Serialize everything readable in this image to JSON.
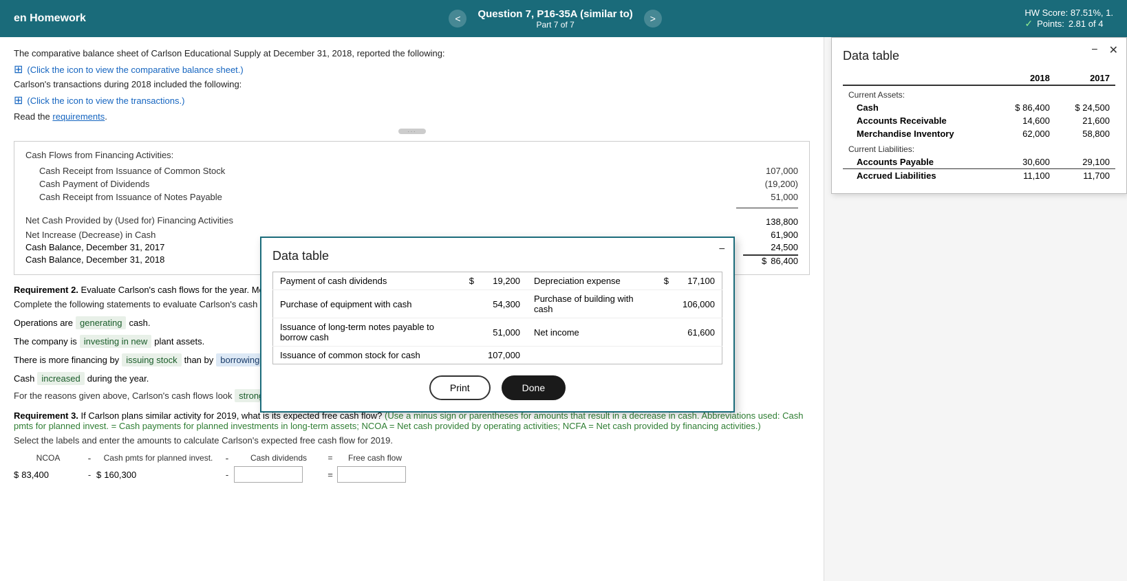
{
  "topBar": {
    "leftTitle": "en Homework",
    "questionTitle": "Question 7, P16-35A (similar to)",
    "partLabel": "Part 7 of 7",
    "hwScore": "HW Score: 87.51%, 1.",
    "pointsLabel": "Points:",
    "pointsValue": "2.81 of 4",
    "navPrev": "<",
    "navNext": ">"
  },
  "intro": {
    "line1": "The comparative balance sheet of Carlson Educational Supply at December 31, 2018, reported the following:",
    "link1": "(Click the icon to view the comparative balance sheet.)",
    "line2": "Carlson's transactions during 2018 included the following:",
    "link2": "(Click the icon to view the transactions.)",
    "readLabel": "Read the",
    "requirementsText": "requirements"
  },
  "cashFlowTable": {
    "sectionHeader": "Cash Flows from Financing Activities:",
    "rows": [
      {
        "label": "Cash Receipt from Issuance of Common Stock",
        "amount": "107,000"
      },
      {
        "label": "Cash Payment of Dividends",
        "amount": "(19,200)"
      },
      {
        "label": "Cash Receipt from Issuance of Notes Payable",
        "amount": "51,000"
      }
    ],
    "netLabel": "Net Cash Provided by (Used for) Financing Activities",
    "netAmount": "138,800",
    "netIncLabel": "Net Increase (Decrease) in Cash",
    "netIncAmount": "61,900",
    "balLabel1": "Cash Balance, December 31, 2017",
    "balAmount1": "24,500",
    "balLabel2": "Cash Balance, December 31, 2018",
    "balDollar": "$",
    "balAmount2": "86,400"
  },
  "req2": {
    "header": "Requirement 2.",
    "headerRest": "Evaluate Carlson's cash flows for the year. Mention all three categories of cash flows, and give the reason for your evaluation.",
    "completeLabel": "Complete the following statements to evaluate Carlson's cash flows.",
    "stmt1Pre": "Operations are",
    "stmt1Highlight": "generating",
    "stmt1Post": "cash.",
    "stmt2Pre": "The company is",
    "stmt2Highlight": "investing in new",
    "stmt2Post": "plant assets.",
    "stmt3Pre": "There is more financing by",
    "stmt3Highlight": "issuing stock",
    "stmt3Mid": "than by",
    "stmt3Highlight2": "borrowing.",
    "stmt4Pre": "Cash",
    "stmt4Highlight": "increased",
    "stmt4Post": "during the year.",
    "evalPre": "For the reasons given above, Carlson's cash flows look",
    "evalHighlight": "strong"
  },
  "req3": {
    "header": "Requirement 3.",
    "headerRest": "If Carlson plans similar activity for 2019, what is its expected free cash flow?",
    "greenNote": "(Use a minus sign or parentheses for amounts that result in a decrease in cash. Abbreviations used: Cash pmts for planned invest. = Cash payments for planned investments in long-term assets; NCOA = Net cash provided by operating activities; NCFA = Net cash provided by financing activities.)",
    "selectLabel": "Select the labels and enter the amounts to calculate Carlson's expected free cash flow for 2019.",
    "calcHeaders": {
      "col1": "NCOA",
      "sep1": "-",
      "col2": "Cash pmts for planned invest.",
      "sep2": "-",
      "col3": "Cash dividends",
      "eq": "=",
      "col4": "Free cash flow"
    },
    "calcValues": {
      "dollar1": "$",
      "val1": "83,400",
      "sep1": "-",
      "dollar2": "$",
      "val2": "160,300",
      "sep2": "-",
      "inputPlaceholder": "",
      "eqSign": "=",
      "resultPlaceholder": ""
    }
  },
  "dataTable1": {
    "title": "Data table",
    "cols": [
      "",
      "2018",
      "2017"
    ],
    "sections": [
      {
        "sectionLabel": "Current Assets:",
        "rows": [
          {
            "label": "Cash",
            "dollar": "$",
            "val2018": "86,400",
            "dollar2": "$",
            "val2017": "24,500"
          },
          {
            "label": "Accounts Receivable",
            "val2018": "14,600",
            "val2017": "21,600"
          },
          {
            "label": "Merchandise Inventory",
            "val2018": "62,000",
            "val2017": "58,800"
          }
        ]
      },
      {
        "sectionLabel": "Current Liabilities:",
        "rows": [
          {
            "label": "Accounts Payable",
            "val2018": "30,600",
            "val2017": "29,100"
          },
          {
            "label": "Accrued Liabilities",
            "val2018": "11,100",
            "val2017": "11,700"
          }
        ]
      }
    ]
  },
  "dataTable2": {
    "title": "Data table",
    "rows": [
      {
        "leftLabel": "Payment of cash dividends",
        "leftDollar": "$",
        "leftAmt": "19,200",
        "rightLabel": "Depreciation expense",
        "rightDollar": "$",
        "rightAmt": "17,100"
      },
      {
        "leftLabel": "Purchase of equipment with cash",
        "leftDollar": "",
        "leftAmt": "54,300",
        "rightLabel": "Purchase of building with cash",
        "rightDollar": "",
        "rightAmt": "106,000"
      },
      {
        "leftLabel": "Issuance of long-term notes payable to borrow cash",
        "leftDollar": "",
        "leftAmt": "51,000",
        "rightLabel": "Net income",
        "rightDollar": "",
        "rightAmt": "61,600"
      },
      {
        "leftLabel": "Issuance of common stock for cash",
        "leftDollar": "",
        "leftAmt": "107,000",
        "rightLabel": "",
        "rightDollar": "",
        "rightAmt": ""
      }
    ],
    "printLabel": "Print",
    "doneLabel": "Done"
  }
}
